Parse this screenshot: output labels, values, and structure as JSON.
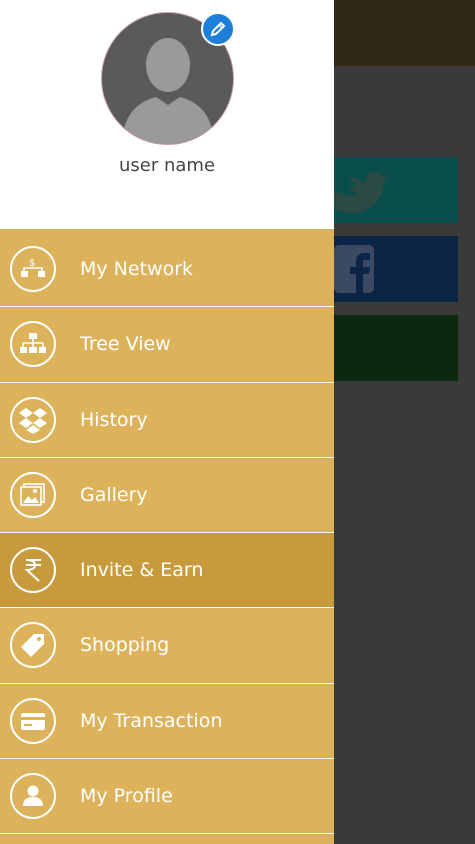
{
  "profile": {
    "username": "user name"
  },
  "menu": [
    {
      "label": "My Network",
      "icon": "network-icon"
    },
    {
      "label": "Tree View",
      "icon": "tree-icon"
    },
    {
      "label": "History",
      "icon": "dropbox-icon"
    },
    {
      "label": "Gallery",
      "icon": "gallery-icon"
    },
    {
      "label": "Invite & Earn",
      "icon": "rupee-icon",
      "active": true
    },
    {
      "label": "Shopping",
      "icon": "tag-icon"
    },
    {
      "label": "My Transaction",
      "icon": "card-icon"
    },
    {
      "label": "My Profile",
      "icon": "user-icon"
    }
  ],
  "colors": {
    "drawer": "#dcb25a",
    "active_item": "#c89a3e",
    "edit_badge": "#1e7fd8",
    "twitter": "#0a4e4c",
    "facebook": "#0c2446",
    "google": "#0c2910"
  }
}
